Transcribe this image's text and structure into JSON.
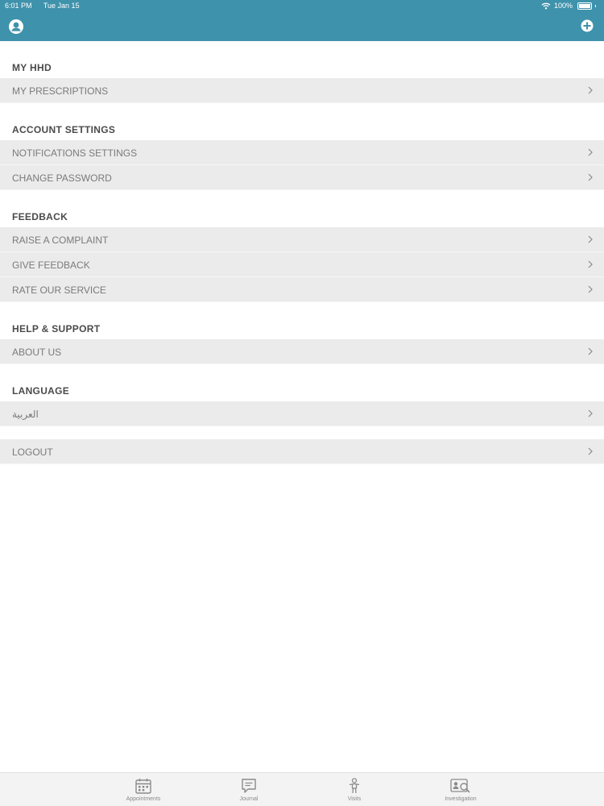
{
  "status_bar": {
    "time": "6:01 PM",
    "date": "Tue Jan 15",
    "battery": "100%"
  },
  "nav": {
    "left_icon": "profile-icon",
    "right_icon": "add-circle-icon"
  },
  "sections": {
    "my_hhd": {
      "title": "MY HHD",
      "items": [
        "MY PRESCRIPTIONS"
      ]
    },
    "account_settings": {
      "title": "ACCOUNT SETTINGS",
      "items": [
        "NOTIFICATIONS SETTINGS",
        "CHANGE PASSWORD"
      ]
    },
    "feedback": {
      "title": "FEEDBACK",
      "items": [
        "RAISE A COMPLAINT",
        "GIVE FEEDBACK",
        "RATE OUR SERVICE"
      ]
    },
    "help_support": {
      "title": "HELP & SUPPORT",
      "items": [
        "ABOUT US"
      ]
    },
    "language": {
      "title": "LANGUAGE",
      "items": [
        "العربية"
      ]
    }
  },
  "logout": "LOGOUT",
  "tabbar": {
    "tabs": [
      "Appointments",
      "Journal",
      "Visits",
      "Investigation"
    ]
  },
  "colors": {
    "header": "#3f92ab",
    "row_background": "#ebebec",
    "section_title": "#4a4a4a",
    "row_text": "#7a7a7a",
    "tab_text": "#8a8a8a"
  }
}
